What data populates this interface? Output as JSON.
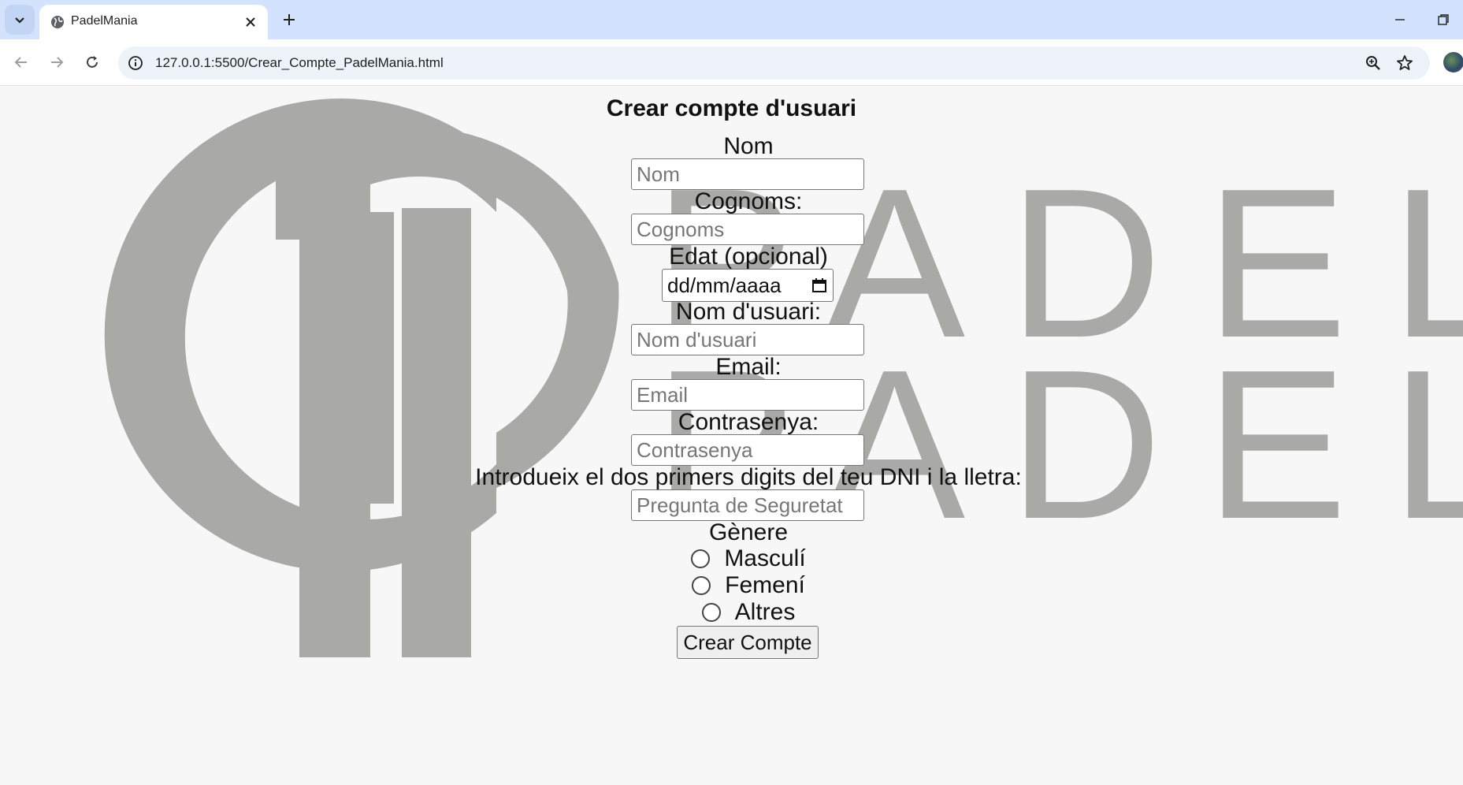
{
  "browser": {
    "tab_title": "PadelMania",
    "url": "127.0.0.1:5500/Crear_Compte_PadelMania.html"
  },
  "watermark": {
    "words": [
      "PADEL",
      "PADEL"
    ],
    "color": "#a9a9a8"
  },
  "form": {
    "title": "Crear compte d'usuari",
    "fields": [
      {
        "label": "Nom",
        "placeholder": "Nom"
      },
      {
        "label": "Cognoms:",
        "placeholder": "Cognoms"
      },
      {
        "label": "Edat (opcional)",
        "value": "dd/mm/aaaa"
      },
      {
        "label": "Nom d'usuari:",
        "placeholder": "Nom d'usuari"
      },
      {
        "label": "Email:",
        "placeholder": "Email"
      },
      {
        "label": "Contrasenya:",
        "placeholder": "Contrasenya"
      },
      {
        "label": "Introdueix el dos primers digits del teu DNI i la lletra:",
        "placeholder": "Pregunta de Seguretat"
      }
    ],
    "gender": {
      "label": "Gènere",
      "options": [
        "Masculí",
        "Femení",
        "Altres"
      ]
    },
    "submit_label": "Crear Compte"
  }
}
